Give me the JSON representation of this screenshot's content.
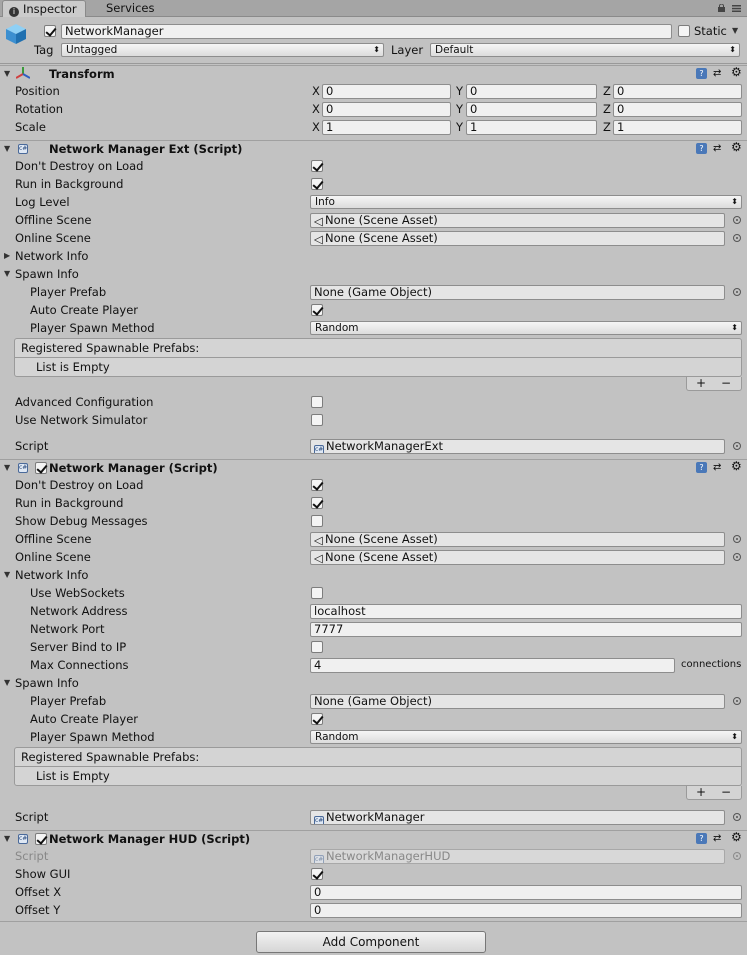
{
  "tabs": [
    {
      "label": "Inspector",
      "icon": "info-icon"
    },
    {
      "label": "Services"
    }
  ],
  "object": {
    "active": true,
    "name": "NetworkManager",
    "static_label": "Static",
    "static_checked": false,
    "tag_label": "Tag",
    "tag_value": "Untagged",
    "layer_label": "Layer",
    "layer_value": "Default"
  },
  "transform": {
    "title": "Transform",
    "rows": [
      {
        "label": "Position",
        "x": "0",
        "y": "0",
        "z": "0"
      },
      {
        "label": "Rotation",
        "x": "0",
        "y": "0",
        "z": "0"
      },
      {
        "label": "Scale",
        "x": "1",
        "y": "1",
        "z": "1"
      }
    ],
    "axis": {
      "x": "X",
      "y": "Y",
      "z": "Z"
    }
  },
  "nm_ext": {
    "title": "Network Manager Ext (Script)",
    "dont_destroy": {
      "label": "Don't Destroy on Load",
      "checked": true
    },
    "run_bg": {
      "label": "Run in Background",
      "checked": true
    },
    "log_level": {
      "label": "Log Level",
      "value": "Info"
    },
    "offline_scene": {
      "label": "Offline Scene",
      "value": "None (Scene Asset)"
    },
    "online_scene": {
      "label": "Online Scene",
      "value": "None (Scene Asset)"
    },
    "network_info": "Network Info",
    "spawn_info": "Spawn Info",
    "player_prefab": {
      "label": "Player Prefab",
      "value": "None (Game Object)"
    },
    "auto_create": {
      "label": "Auto Create Player",
      "checked": true
    },
    "spawn_method": {
      "label": "Player Spawn Method",
      "value": "Random"
    },
    "registered": "Registered Spawnable Prefabs:",
    "list_empty": "List is Empty",
    "advanced": {
      "label": "Advanced Configuration",
      "checked": false
    },
    "simulator": {
      "label": "Use Network Simulator",
      "checked": false
    },
    "script": {
      "label": "Script",
      "value": "NetworkManagerExt"
    }
  },
  "nm": {
    "title": "Network Manager (Script)",
    "dont_destroy": {
      "label": "Don't Destroy on Load",
      "checked": true
    },
    "run_bg": {
      "label": "Run in Background",
      "checked": true
    },
    "debug": {
      "label": "Show Debug Messages",
      "checked": false
    },
    "offline_scene": {
      "label": "Offline Scene",
      "value": "None (Scene Asset)"
    },
    "online_scene": {
      "label": "Online Scene",
      "value": "None (Scene Asset)"
    },
    "network_info": "Network Info",
    "websockets": {
      "label": "Use WebSockets",
      "checked": false
    },
    "address": {
      "label": "Network Address",
      "value": "localhost"
    },
    "port": {
      "label": "Network Port",
      "value": "7777"
    },
    "bind_ip": {
      "label": "Server Bind to IP",
      "checked": false
    },
    "max_conn": {
      "label": "Max Connections",
      "value": "4",
      "unit": "connections"
    },
    "spawn_info": "Spawn Info",
    "player_prefab": {
      "label": "Player Prefab",
      "value": "None (Game Object)"
    },
    "auto_create": {
      "label": "Auto Create Player",
      "checked": true
    },
    "spawn_method": {
      "label": "Player Spawn Method",
      "value": "Random"
    },
    "registered": "Registered Spawnable Prefabs:",
    "list_empty": "List is Empty",
    "script": {
      "label": "Script",
      "value": "NetworkManager"
    }
  },
  "hud": {
    "title": "Network Manager HUD (Script)",
    "script": {
      "label": "Script",
      "value": "NetworkManagerHUD"
    },
    "show_gui": {
      "label": "Show GUI",
      "checked": true
    },
    "offset_x": {
      "label": "Offset X",
      "value": "0"
    },
    "offset_y": {
      "label": "Offset Y",
      "value": "0"
    }
  },
  "add_component": "Add Component",
  "list_buttons": {
    "plus": "+",
    "minus": "−"
  },
  "colors": {
    "background": "#c2c2c2",
    "field": "#f0f0f0",
    "help_icon": "#4a78b8"
  }
}
